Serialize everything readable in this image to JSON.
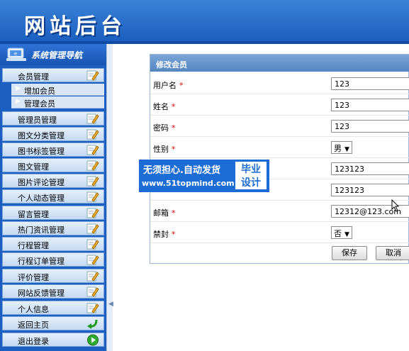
{
  "header": {
    "title": "网站后台"
  },
  "sidebar": {
    "nav_title": "系统管理导航",
    "items": [
      {
        "label": "会员管理",
        "icon": "edit-icon",
        "expanded": true,
        "subitems": [
          "增加会员",
          "管理会员"
        ]
      },
      {
        "label": "管理员管理",
        "icon": "edit-icon"
      },
      {
        "label": "图文分类管理",
        "icon": "edit-icon"
      },
      {
        "label": "图书标签管理",
        "icon": "edit-icon"
      },
      {
        "label": "图文管理",
        "icon": "edit-icon"
      },
      {
        "label": "图片评论管理",
        "icon": "edit-icon"
      },
      {
        "label": "个人动态管理",
        "icon": "edit-icon"
      },
      {
        "label": "留言管理",
        "icon": "edit-icon"
      },
      {
        "label": "热门资讯管理",
        "icon": "edit-icon"
      },
      {
        "label": "行程管理",
        "icon": "edit-icon"
      },
      {
        "label": "行程订单管理",
        "icon": "edit-icon"
      },
      {
        "label": "评价管理",
        "icon": "edit-icon"
      },
      {
        "label": "网站反馈管理",
        "icon": "edit-icon"
      },
      {
        "label": "个人信息",
        "icon": "edit-icon"
      },
      {
        "label": "返回主页",
        "icon": "return-arrow-icon"
      },
      {
        "label": "退出登录",
        "icon": "play-circle-icon"
      }
    ]
  },
  "form": {
    "title": "修改会员",
    "required_mark": "*",
    "fields": [
      {
        "label": "用户名",
        "value": "123"
      },
      {
        "label": "姓名",
        "value": "123"
      },
      {
        "label": "密码",
        "value": "123"
      },
      {
        "label": "性别",
        "value": "男"
      },
      {
        "label": "",
        "value": "123123"
      },
      {
        "label": "",
        "value": "123123"
      },
      {
        "label": "邮箱",
        "value": "12312@123.com"
      },
      {
        "label": "禁封",
        "value": "否"
      }
    ],
    "save_label": "保存",
    "cancel_label": "取消"
  },
  "watermark": {
    "line1": "无须担心.自动发货",
    "line2": "www.51topmind.com",
    "box_line1": "毕业",
    "box_line2": "设计"
  },
  "colors": {
    "header_blue": "#1b5fc0",
    "sidebar_blue": "#1d5fc1",
    "required_red": "#e00000",
    "panel_header": "#5585c2"
  }
}
